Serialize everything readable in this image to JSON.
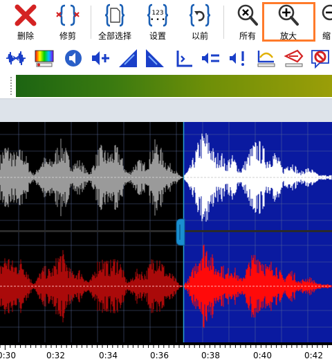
{
  "toolbar": {
    "delete_label": "删除",
    "trim_label": "修剪",
    "select_all_label": "全部选择",
    "settings_label": "设置",
    "undo_label": "以前",
    "zoom_all_label": "所有",
    "zoom_in_label": "放大",
    "zoom_out_label": "缩"
  },
  "icons": {
    "settings_icon_text": "123"
  },
  "colors": {
    "accent_highlight": "#ff7a2a",
    "selection_background": "#0a1aa0",
    "top_channel_wave": "#9a9a9a",
    "bottom_channel_wave": "#aa0a0a",
    "selected_top_wave": "#ffffff",
    "selected_bottom_wave": "#ff0a0a"
  },
  "timeline": {
    "labels": [
      "0:30",
      "0:32",
      "0:34",
      "0:36",
      "0:38",
      "0:40",
      "0:42"
    ]
  }
}
